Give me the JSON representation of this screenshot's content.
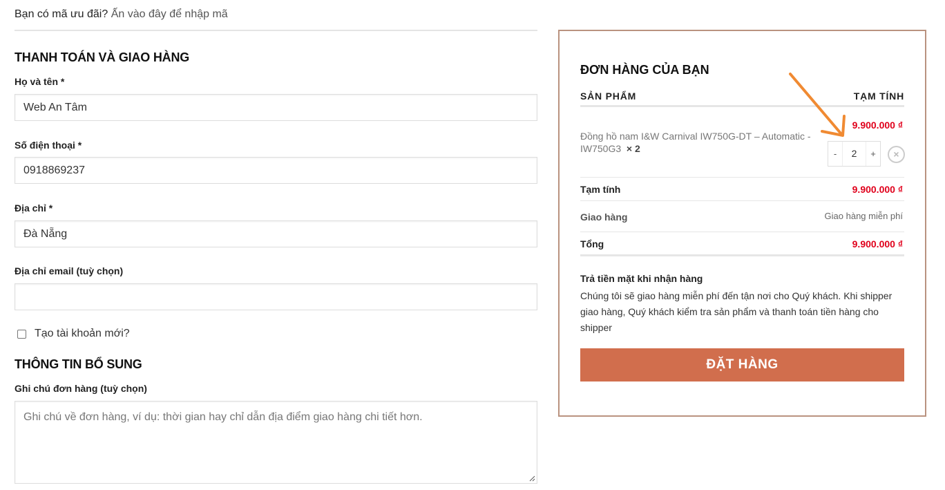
{
  "coupon": {
    "prompt": "Bạn có mã ưu đãi?",
    "link": "Ấn vào đây để nhập mã"
  },
  "billing": {
    "title": "THANH TOÁN VÀ GIAO HÀNG",
    "name_label": "Họ và tên *",
    "name_value": "Web An Tâm",
    "phone_label": "Số điện thoại *",
    "phone_value": "0918869237",
    "address_label": "Địa chỉ *",
    "address_value": "Đà Nẵng",
    "email_label": "Địa chỉ email (tuỳ chọn)",
    "email_value": "",
    "create_account_label": "Tạo tài khoản mới?"
  },
  "additional": {
    "title": "THÔNG TIN BỔ SUNG",
    "notes_label": "Ghi chú đơn hàng (tuỳ chọn)",
    "notes_placeholder": "Ghi chú về đơn hàng, ví dụ: thời gian hay chỉ dẫn địa điểm giao hàng chi tiết hơn."
  },
  "order": {
    "title": "ĐƠN HÀNG CỦA BẠN",
    "col_product": "SẢN PHẨM",
    "col_subtotal": "TẠM TÍNH",
    "item": {
      "name": "Đồng hồ nam I&W Carnival IW750G-DT – Automatic - IW750G3",
      "qty_label": "× 2",
      "price": "9.900.000 ₫",
      "qty_minus": "-",
      "qty_value": "2",
      "qty_plus": "+",
      "remove": "×"
    },
    "subtotal_label": "Tạm tính",
    "subtotal_value": "9.900.000 ₫",
    "shipping_label": "Giao hàng",
    "shipping_value": "Giao hàng miễn phí",
    "total_label": "Tổng",
    "total_value": "9.900.000 ₫",
    "payment_title": "Trả tiền mặt khi nhận hàng",
    "payment_desc": "Chúng tôi sẽ giao hàng miễn phí đến tận nơi cho Quý khách. Khi shipper giao hàng, Quý khách kiểm tra sản phẩm và thanh toán tiền hàng cho shipper",
    "place_order": "ĐẶT HÀNG"
  },
  "colors": {
    "price": "#e0001b",
    "button": "#d16e4d",
    "border": "#b9927f",
    "arrow": "#f08a32"
  }
}
